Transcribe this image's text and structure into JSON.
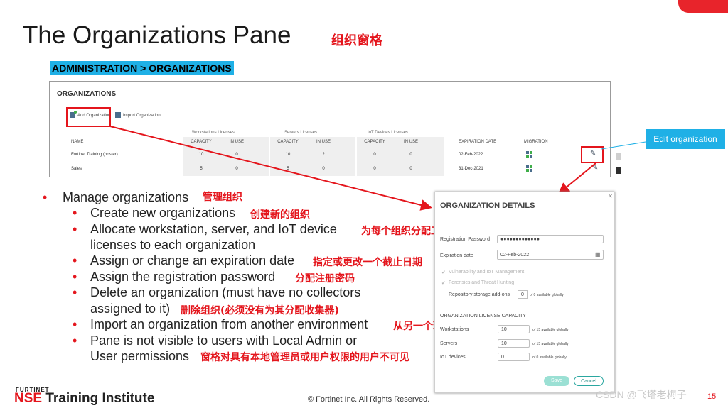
{
  "slide": {
    "title": "The Organizations Pane",
    "title_cn": "组织窗格",
    "breadcrumb": "ADMINISTRATION > ORGANIZATIONS",
    "page_number": "15",
    "footer": "© Fortinet Inc. All Rights Reserved.",
    "logo_small": "FURTINET",
    "logo_nse": "NSE",
    "logo_rest": " Training Institute",
    "watermark": "CSDN @飞塔老梅子",
    "callout": "Edit organization",
    "accent_color": "#e4151c",
    "callout_color": "#1fb0e6"
  },
  "panel": {
    "title": "ORGANIZATIONS",
    "add_label": "Add Organization",
    "import_label": "Import Organization",
    "groups": [
      "Workstations Licenses",
      "Servers Licenses",
      "IoT Devices Licenses"
    ],
    "headers": {
      "name": "NAME",
      "capacity": "CAPACITY",
      "in_use": "IN USE",
      "expiration": "EXPIRATION DATE",
      "migration": "MIGRATION"
    },
    "rows": [
      {
        "name": "Fortinet Training (hoster)",
        "ws_cap": "10",
        "ws_use": "0",
        "srv_cap": "10",
        "srv_use": "2",
        "iot_cap": "0",
        "iot_use": "0",
        "expiration": "02-Feb-2022"
      },
      {
        "name": "Sales",
        "ws_cap": "5",
        "ws_use": "0",
        "srv_cap": "5",
        "srv_use": "0",
        "iot_cap": "0",
        "iot_use": "0",
        "expiration": "31-Dec-2021"
      }
    ]
  },
  "bullets": {
    "manage": "Manage organizations",
    "manage_cn": "管理组织",
    "create": "Create new organizations",
    "create_cn": "创建新的组织",
    "allocate": "Allocate workstation, server, and IoT device",
    "allocate_cont": "licenses to each organization",
    "allocate_cn": "为每个组织分配工作站、服务器和IoT设备许可证",
    "expire": "Assign or change an expiration date",
    "expire_cn": "指定或更改一个截止日期",
    "password": "Assign the registration password",
    "password_cn": "分配注册密码",
    "delete": "Delete an organization (must have no collectors",
    "delete_cont": "assigned to it)",
    "delete_cn": "删除组织(必须没有为其分配收集器)",
    "import": "Import an organization from another environment",
    "import_cn": "从另一个环境导入组织",
    "visible": "Pane is not visible to users with Local Admin or",
    "visible_cont": "User permissions",
    "visible_cn": "窗格对具有本地管理员或用户权限的用户不可见"
  },
  "dialog": {
    "title": "ORGANIZATION DETAILS",
    "reg_password_label": "Registration Password",
    "reg_password_value": "●●●●●●●●●●●●●",
    "expiration_label": "Expiration date",
    "expiration_value": "02-Feb-2022",
    "vuln_label": "Vulnerability and IoT Management",
    "forensics_label": "Forensics and Threat Hunting",
    "repo_label": "Repository storage add-ons",
    "repo_value": "0",
    "repo_note": "of 0 available globally",
    "capacity_title": "ORGANIZATION LICENSE CAPACITY",
    "ws_label": "Workstations",
    "ws_value": "10",
    "ws_note": "of 15 available globally",
    "srv_label": "Servers",
    "srv_value": "10",
    "srv_note": "of 15 available globally",
    "iot_label": "IoT devices",
    "iot_value": "0",
    "iot_note": "of 0 available globally",
    "save": "Save",
    "cancel": "Cancel"
  }
}
